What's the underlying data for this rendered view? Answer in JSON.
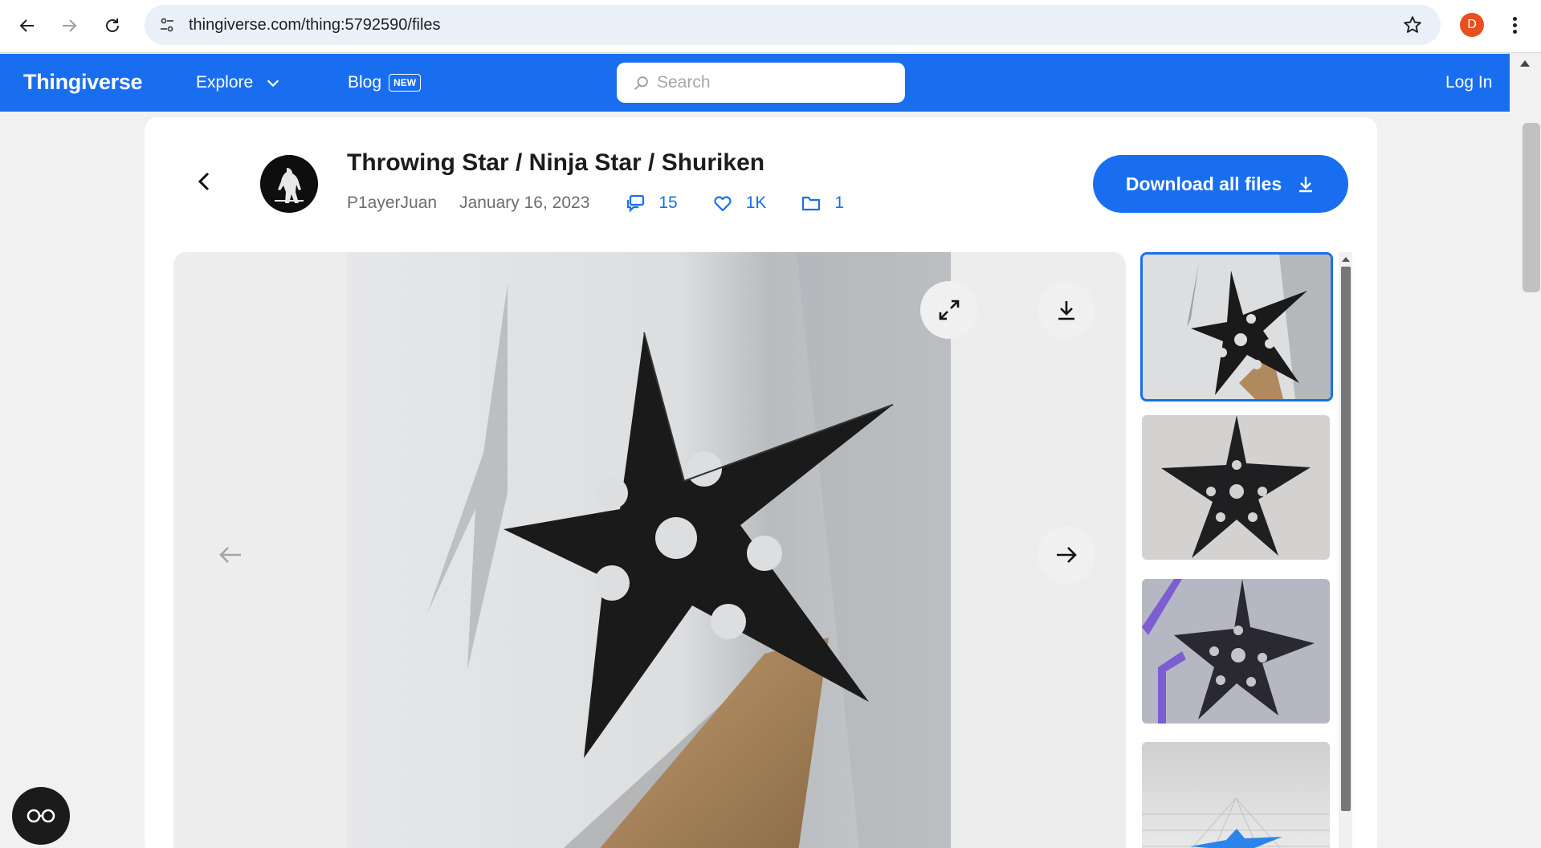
{
  "browser": {
    "url": "thingiverse.com/thing:5792590/files",
    "profile_initial": "D"
  },
  "header": {
    "logo": "Thingiverse",
    "explore_label": "Explore",
    "blog_label": "Blog",
    "blog_badge": "NEW",
    "search_placeholder": "Search",
    "login_label": "Log In"
  },
  "thing": {
    "title": "Throwing Star / Ninja Star / Shuriken",
    "author": "P1ayerJuan",
    "date": "January 16, 2023",
    "comments": "15",
    "likes": "1K",
    "files": "1",
    "download_all_label": "Download all files"
  },
  "viewer": {
    "image_description_icon": "shuriken-photo",
    "thumbnail_count_visible": 4
  },
  "colors": {
    "brand_blue": "#196ef0",
    "page_bg": "#f1f1f1",
    "viewer_bg": "#ededed"
  }
}
